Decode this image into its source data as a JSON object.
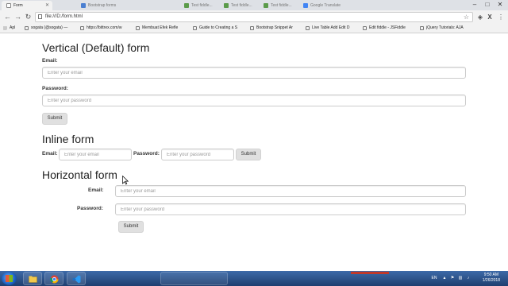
{
  "browser": {
    "tabs": [
      {
        "title": "Form",
        "active": true
      },
      {
        "title": "Bootstrap forms",
        "active": false
      },
      {
        "title": "Test fiddle...",
        "active": false
      },
      {
        "title": "Test fiddle...",
        "active": false
      },
      {
        "title": "Test fiddle...",
        "active": false
      },
      {
        "title": "Google Translate",
        "active": false
      }
    ],
    "address": "file:///D:/form.html",
    "bookmarks": [
      {
        "label": "Apl",
        "type": "apps"
      },
      {
        "label": "sogata (@sogata) —"
      },
      {
        "label": "https://bittrex.com/w"
      },
      {
        "label": "Membuat Efek Refle"
      },
      {
        "label": "Guide to Creating a S"
      },
      {
        "label": "Bootstrap Snippet Ar"
      },
      {
        "label": "Live Table Add Edit D"
      },
      {
        "label": "Edit fiddle - JSFiddle"
      },
      {
        "label": "jQuery Tutorials: AJA"
      }
    ]
  },
  "page": {
    "vertical": {
      "title": "Vertical (Default) form",
      "email_label": "Email:",
      "email_placeholder": "Enter your email",
      "password_label": "Password:",
      "password_placeholder": "Enter your password",
      "submit_label": "Submit"
    },
    "inline": {
      "title": "Inline form",
      "email_label": "Email:",
      "email_placeholder": "Enter your email",
      "password_label": "Password:",
      "password_placeholder": "Enter your password",
      "submit_label": "Submit"
    },
    "horizontal": {
      "title": "Horizontal form",
      "email_label": "Email:",
      "email_placeholder": "Enter your email",
      "password_label": "Password:",
      "password_placeholder": "Enter your password",
      "submit_label": "Submit"
    }
  },
  "taskbar": {
    "apps": [
      {
        "icon": "folder-icon",
        "label": ""
      },
      {
        "icon": "chrome-icon",
        "label": ""
      },
      {
        "icon": "vscode-icon",
        "label": ""
      }
    ],
    "language": "EN",
    "time": "9:50 AM",
    "date": "1/26/2018"
  }
}
